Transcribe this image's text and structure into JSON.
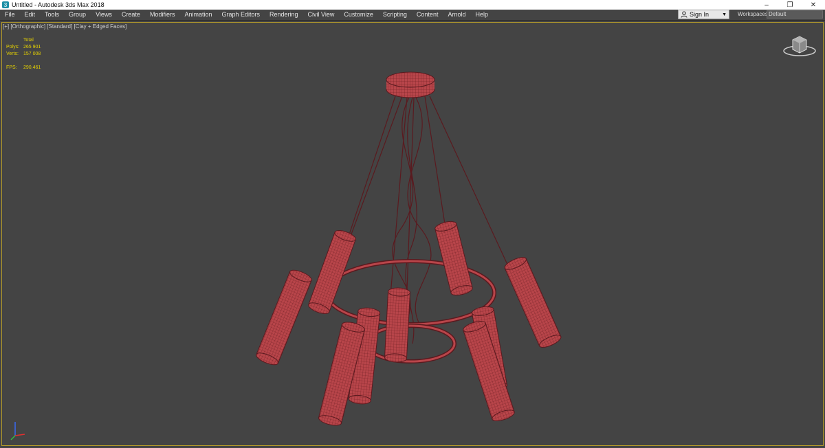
{
  "titlebar": {
    "title": "Untitled - Autodesk 3ds Max 2018",
    "app_icon": "3ds-max-icon",
    "minimize": "–",
    "restore": "❐",
    "close": "✕"
  },
  "menubar": {
    "items": [
      "File",
      "Edit",
      "Tools",
      "Group",
      "Views",
      "Create",
      "Modifiers",
      "Animation",
      "Graph Editors",
      "Rendering",
      "Civil View",
      "Customize",
      "Scripting",
      "Content",
      "Arnold",
      "Help"
    ],
    "signin_label": "Sign In",
    "signin_icon": "user-icon",
    "workspaces_label": "Workspaces:",
    "workspaces_value": "Default"
  },
  "viewport": {
    "label_plus": "[+]",
    "label_view": "[Orthographic]",
    "label_shading": "[Standard]",
    "label_mode": "[Clay + Edged Faces]",
    "stats": {
      "header": "Total",
      "polys_label": "Polys:",
      "polys_value": "265 901",
      "verts_label": "Verts:",
      "verts_value": "157 008",
      "fps_label": "FPS:",
      "fps_value": "290,461"
    },
    "mesh_color": "#b8454a",
    "wire_color": "#5a1a1f",
    "outline_color": "#b59b2a",
    "stats_color": "#e6d200"
  }
}
